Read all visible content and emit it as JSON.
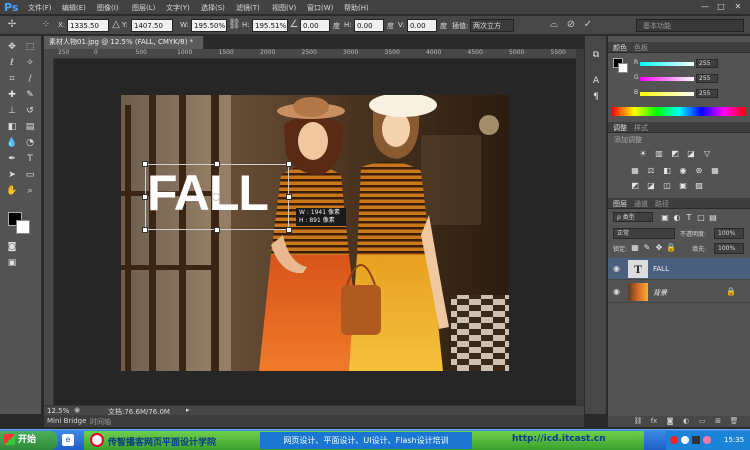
{
  "app": {
    "logo": "Ps"
  },
  "menu": [
    "文件(F)",
    "编辑(E)",
    "图像(I)",
    "图层(L)",
    "文字(Y)",
    "选择(S)",
    "滤镜(T)",
    "视图(V)",
    "窗口(W)",
    "帮助(H)"
  ],
  "window_controls": [
    "—",
    "□",
    "✕"
  ],
  "options": {
    "x_label": "X:",
    "x": "1335.50 像",
    "y_label": "Y:",
    "y": "1407.50 像",
    "w_label": "W:",
    "w": "195.50%",
    "h_label": "H:",
    "h": "195.51%",
    "angle_val": "0.00",
    "deg1": "度",
    "h2_label": "H:",
    "h2": "0.00",
    "deg2": "度",
    "v_label": "V:",
    "v": "0.00",
    "deg3": "度",
    "interp_label": "插值:",
    "interp": "两次立方",
    "workspace": "基本功能"
  },
  "document": {
    "tab_title": "素材人物01.jpg @ 12.5% (FALL, CMYK/8) *",
    "close": "×"
  },
  "ruler_ticks": [
    "250",
    "0",
    "500",
    "1000",
    "1500",
    "2000",
    "2500",
    "3000",
    "3500",
    "4000",
    "4500",
    "5000",
    "5500",
    "6000"
  ],
  "canvas_text": {
    "main": "FALL",
    "size_w": "W :  1941  像素",
    "size_h": "H :    891  像素"
  },
  "status": {
    "zoom": "12.5%",
    "doc": "文档:76.6M/76.0M"
  },
  "bottom_tabs": {
    "mini_bridge": "Mini Bridge",
    "timeline": "时间轴"
  },
  "color_panel": {
    "tabs": [
      "颜色",
      "色板"
    ],
    "channels": [
      {
        "label": "R",
        "value": "255"
      },
      {
        "label": "G",
        "value": "255"
      },
      {
        "label": "B",
        "value": "255"
      }
    ]
  },
  "adjust_panel": {
    "tabs": [
      "调整",
      "样式"
    ],
    "title": "添加调整"
  },
  "layers_panel": {
    "tabs": [
      "图层",
      "通道",
      "路径"
    ],
    "kind": "ρ 类型",
    "blend": "正常",
    "opacity_label": "不透明度:",
    "opacity": "100%",
    "lock_label": "锁定:",
    "fill_label": "填充:",
    "fill": "100%",
    "layers": [
      {
        "name": "FALL",
        "type": "text",
        "selected": true
      },
      {
        "name": "背景",
        "type": "image",
        "locked": true
      }
    ]
  },
  "taskbar": {
    "start": "开始",
    "org": "传智播客网页平面设计学院",
    "courses": "网页设计、平面设计、UI设计、Flash设计培训",
    "url": "http://icd.itcast.cn",
    "time": "15:35"
  },
  "colors": {
    "accent": "#4aa3ff",
    "banner": "#3aa02e",
    "selection": "#4b5f7f"
  }
}
